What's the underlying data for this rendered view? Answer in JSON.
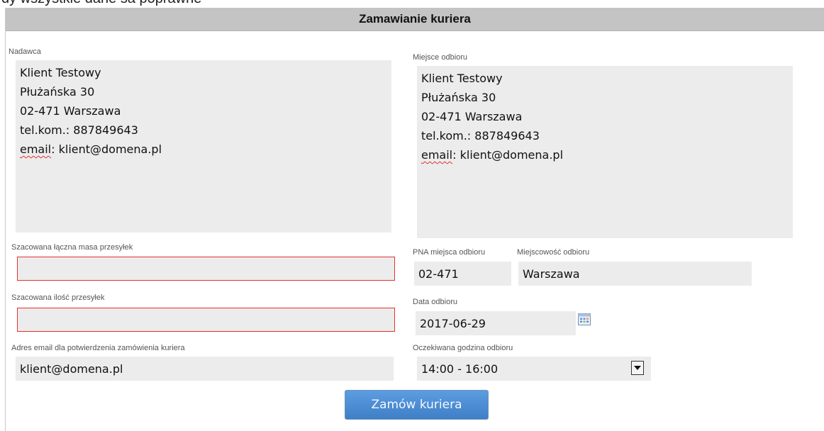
{
  "top_fragment": "dy wszystkie dane sa poprawne",
  "header": {
    "title": "Zamawianie kuriera"
  },
  "sender": {
    "label": "Nadawca",
    "lines": [
      "Klient Testowy",
      "Płużańska 30",
      "02-471 Warszawa",
      "tel.kom.: 887849643"
    ],
    "email_prefix": "email",
    "email_rest": ": klient@domena.pl"
  },
  "pickup_place": {
    "label": "Miejsce odbioru",
    "lines": [
      "Klient Testowy",
      "Płużańska 30",
      "02-471 Warszawa",
      "tel.kom.: 887849643"
    ],
    "email_prefix": "email",
    "email_rest": ": klient@domena.pl"
  },
  "total_mass": {
    "label": "Szacowana łączna masa przesyłek",
    "value": ""
  },
  "parcel_count": {
    "label": "Szacowana ilość przesyłek",
    "value": ""
  },
  "confirmation_email": {
    "label": "Adres email dla potwierdzenia zamówienia kuriera",
    "value": "klient@domena.pl"
  },
  "pickup_postcode": {
    "label": "PNA miejsca odbioru",
    "value": "02-471"
  },
  "pickup_city": {
    "label": "Miejscowość odbioru",
    "value": "Warszawa"
  },
  "pickup_date": {
    "label": "Data odbioru",
    "value": "2017-06-29",
    "icon": "calendar-icon"
  },
  "pickup_time": {
    "label": "Oczekiwana godzina odbioru",
    "selected": "14:00 - 16:00",
    "icon": "dropdown-arrow-icon"
  },
  "submit": {
    "label": "Zamów kuriera"
  },
  "colors": {
    "header_bg": "#c4c4c4",
    "field_bg": "#ececec",
    "invalid_border": "#e53131",
    "button": "#4a8bd2"
  }
}
